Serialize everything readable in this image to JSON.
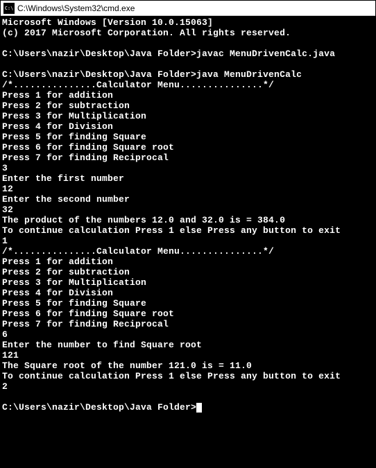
{
  "window": {
    "title": "C:\\Windows\\System32\\cmd.exe",
    "icon_name": "cmd-icon"
  },
  "terminal": {
    "lines": [
      "Microsoft Windows [Version 10.0.15063]",
      "(c) 2017 Microsoft Corporation. All rights reserved.",
      "",
      "C:\\Users\\nazir\\Desktop\\Java Folder>javac MenuDrivenCalc.java",
      "",
      "C:\\Users\\nazir\\Desktop\\Java Folder>java MenuDrivenCalc",
      "/*...............Calculator Menu...............*/",
      "Press 1 for addition",
      "Press 2 for subtraction",
      "Press 3 for Multiplication",
      "Press 4 for Division",
      "Press 5 for finding Square",
      "Press 6 for finding Square root",
      "Press 7 for finding Reciprocal",
      "3",
      "Enter the first number",
      "12",
      "Enter the second number",
      "32",
      "The product of the numbers 12.0 and 32.0 is = 384.0",
      "To continue calculation Press 1 else Press any button to exit",
      "1",
      "/*...............Calculator Menu...............*/",
      "Press 1 for addition",
      "Press 2 for subtraction",
      "Press 3 for Multiplication",
      "Press 4 for Division",
      "Press 5 for finding Square",
      "Press 6 for finding Square root",
      "Press 7 for finding Reciprocal",
      "6",
      "Enter the number to find Square root",
      "121",
      "The Square root of the number 121.0 is = 11.0",
      "To continue calculation Press 1 else Press any button to exit",
      "2",
      "",
      "C:\\Users\\nazir\\Desktop\\Java Folder>"
    ],
    "prompt_line_index": 37
  }
}
